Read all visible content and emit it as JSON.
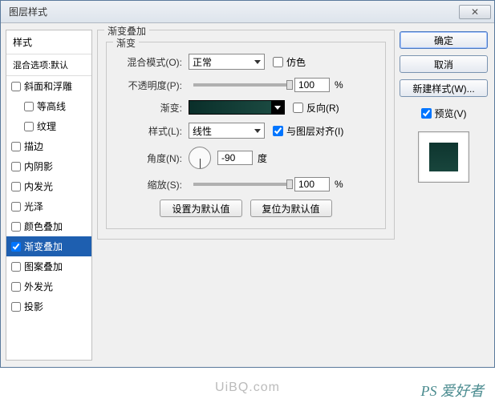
{
  "title": "图层样式",
  "close_glyph": "✕",
  "sidebar": {
    "header": "样式",
    "sub": "混合选项:默认",
    "items": [
      {
        "label": "斜面和浮雕",
        "checked": false,
        "indent": false
      },
      {
        "label": "等高线",
        "checked": false,
        "indent": true
      },
      {
        "label": "纹理",
        "checked": false,
        "indent": true
      },
      {
        "label": "描边",
        "checked": false,
        "indent": false
      },
      {
        "label": "内阴影",
        "checked": false,
        "indent": false
      },
      {
        "label": "内发光",
        "checked": false,
        "indent": false
      },
      {
        "label": "光泽",
        "checked": false,
        "indent": false
      },
      {
        "label": "颜色叠加",
        "checked": false,
        "indent": false
      },
      {
        "label": "渐变叠加",
        "checked": true,
        "indent": false,
        "selected": true
      },
      {
        "label": "图案叠加",
        "checked": false,
        "indent": false
      },
      {
        "label": "外发光",
        "checked": false,
        "indent": false
      },
      {
        "label": "投影",
        "checked": false,
        "indent": false
      }
    ]
  },
  "panel": {
    "group_title": "渐变叠加",
    "inner_title": "渐变",
    "blend_mode_label": "混合模式(O):",
    "blend_mode_value": "正常",
    "dither_label": "仿色",
    "opacity_label": "不透明度(P):",
    "opacity_value": "100",
    "opacity_pct": "%",
    "gradient_label": "渐变:",
    "reverse_label": "反向(R)",
    "style_label": "样式(L):",
    "style_value": "线性",
    "align_label": "与图层对齐(I)",
    "angle_label": "角度(N):",
    "angle_value": "-90",
    "angle_unit": "度",
    "scale_label": "缩放(S):",
    "scale_value": "100",
    "scale_pct": "%",
    "default_btn": "设置为默认值",
    "reset_btn": "复位为默认值"
  },
  "right": {
    "ok": "确定",
    "cancel": "取消",
    "new_style": "新建样式(W)...",
    "preview_label": "预览(V)",
    "preview_checked": true
  },
  "watermark": "PS 爱好者",
  "url": "UiBQ.com"
}
